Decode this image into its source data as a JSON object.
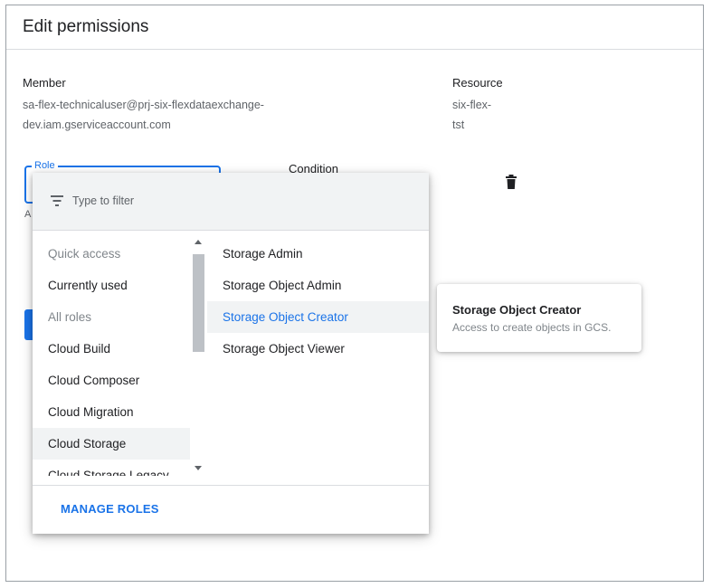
{
  "dialog": {
    "title": "Edit permissions"
  },
  "member": {
    "label": "Member",
    "value_line1": "sa-flex-technicaluser@prj-six-flexdataexchange-",
    "value_line2": "dev.iam.gserviceaccount.com"
  },
  "resource": {
    "label": "Resource",
    "value_line1": "six-flex-",
    "value_line2": "tst"
  },
  "role_field": {
    "label": "Role",
    "helper_stub": "A"
  },
  "condition": {
    "label": "Condition"
  },
  "filter": {
    "placeholder": "Type to filter",
    "value": ""
  },
  "categories": [
    {
      "label": "Quick access",
      "type": "header"
    },
    {
      "label": "Currently used",
      "type": "item"
    },
    {
      "label": "All roles",
      "type": "header"
    },
    {
      "label": "Cloud Build",
      "type": "item"
    },
    {
      "label": "Cloud Composer",
      "type": "item"
    },
    {
      "label": "Cloud Migration",
      "type": "item"
    },
    {
      "label": "Cloud Storage",
      "type": "item",
      "selected": true
    },
    {
      "label": "Cloud Storage Legacy",
      "type": "item"
    }
  ],
  "roles": [
    {
      "label": "Storage Admin"
    },
    {
      "label": "Storage Object Admin"
    },
    {
      "label": "Storage Object Creator",
      "active": true
    },
    {
      "label": "Storage Object Viewer"
    }
  ],
  "footer": {
    "manage_roles": "MANAGE ROLES"
  },
  "tooltip": {
    "title": "Storage Object Creator",
    "description": "Access to create objects in GCS."
  },
  "icons": {
    "filter": "filter-icon",
    "delete": "trash-icon",
    "scroll_up": "chevron-up-icon",
    "scroll_down": "chevron-down-icon"
  },
  "colors": {
    "accent": "#1a73e8",
    "selected_bg": "#f1f3f4",
    "muted_text": "#5f6368"
  }
}
